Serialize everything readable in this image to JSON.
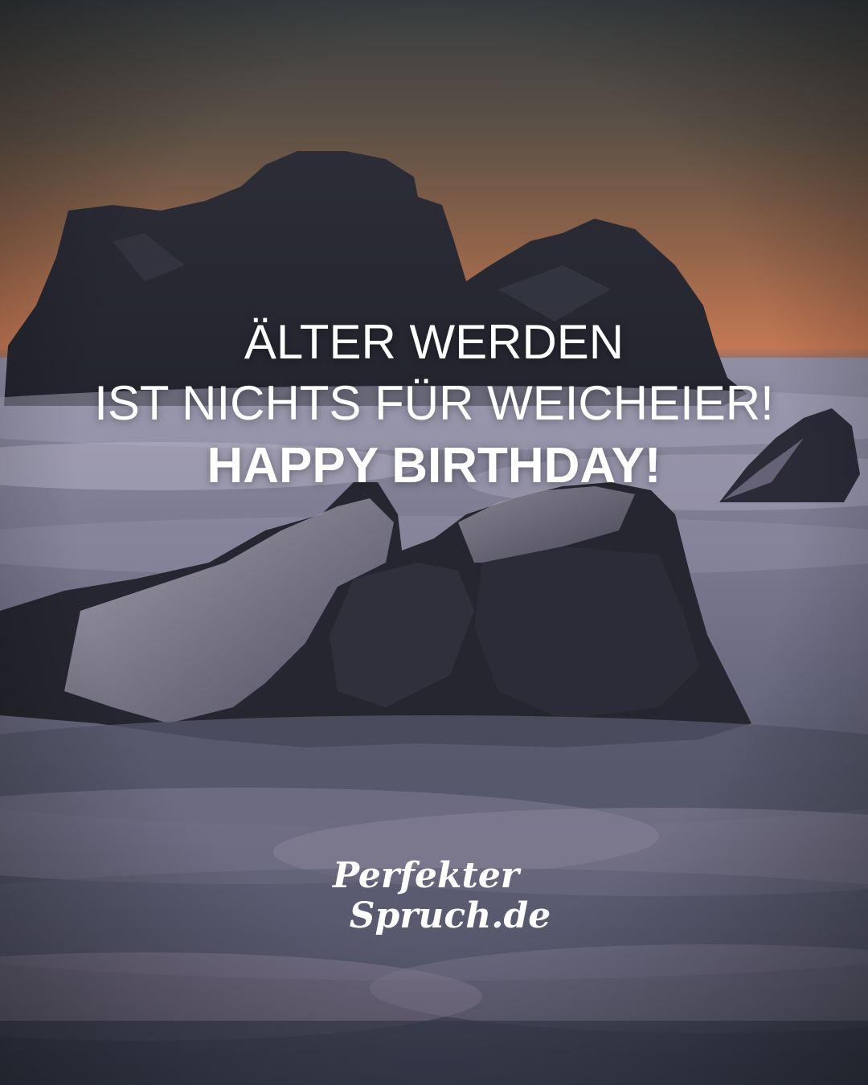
{
  "image": {
    "description_colors": {
      "sky_top": "#3c4145",
      "sky_mid": "#a8694e",
      "horizon": "#d37a55",
      "clouds": "#b7b3c4",
      "rock": "#2a2b36"
    }
  },
  "quote": {
    "line1": "ÄLTER WERDEN",
    "line2": "IST NICHTS FÜR WEICHEIER!",
    "line3": "HAPPY BIRTHDAY!"
  },
  "logo": {
    "word1": "Perfekter",
    "word2": "Spruch.de"
  }
}
